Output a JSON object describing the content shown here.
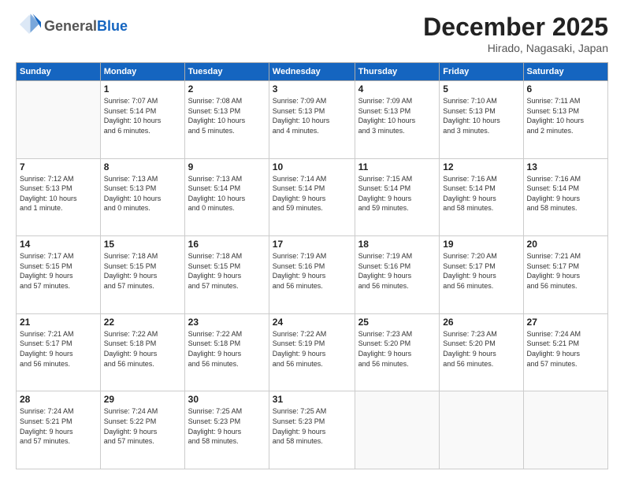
{
  "logo": {
    "general": "General",
    "blue": "Blue"
  },
  "header": {
    "month": "December 2025",
    "location": "Hirado, Nagasaki, Japan"
  },
  "days_of_week": [
    "Sunday",
    "Monday",
    "Tuesday",
    "Wednesday",
    "Thursday",
    "Friday",
    "Saturday"
  ],
  "weeks": [
    [
      {
        "day": "",
        "info": ""
      },
      {
        "day": "1",
        "info": "Sunrise: 7:07 AM\nSunset: 5:14 PM\nDaylight: 10 hours\nand 6 minutes."
      },
      {
        "day": "2",
        "info": "Sunrise: 7:08 AM\nSunset: 5:13 PM\nDaylight: 10 hours\nand 5 minutes."
      },
      {
        "day": "3",
        "info": "Sunrise: 7:09 AM\nSunset: 5:13 PM\nDaylight: 10 hours\nand 4 minutes."
      },
      {
        "day": "4",
        "info": "Sunrise: 7:09 AM\nSunset: 5:13 PM\nDaylight: 10 hours\nand 3 minutes."
      },
      {
        "day": "5",
        "info": "Sunrise: 7:10 AM\nSunset: 5:13 PM\nDaylight: 10 hours\nand 3 minutes."
      },
      {
        "day": "6",
        "info": "Sunrise: 7:11 AM\nSunset: 5:13 PM\nDaylight: 10 hours\nand 2 minutes."
      }
    ],
    [
      {
        "day": "7",
        "info": "Sunrise: 7:12 AM\nSunset: 5:13 PM\nDaylight: 10 hours\nand 1 minute."
      },
      {
        "day": "8",
        "info": "Sunrise: 7:13 AM\nSunset: 5:13 PM\nDaylight: 10 hours\nand 0 minutes."
      },
      {
        "day": "9",
        "info": "Sunrise: 7:13 AM\nSunset: 5:14 PM\nDaylight: 10 hours\nand 0 minutes."
      },
      {
        "day": "10",
        "info": "Sunrise: 7:14 AM\nSunset: 5:14 PM\nDaylight: 9 hours\nand 59 minutes."
      },
      {
        "day": "11",
        "info": "Sunrise: 7:15 AM\nSunset: 5:14 PM\nDaylight: 9 hours\nand 59 minutes."
      },
      {
        "day": "12",
        "info": "Sunrise: 7:16 AM\nSunset: 5:14 PM\nDaylight: 9 hours\nand 58 minutes."
      },
      {
        "day": "13",
        "info": "Sunrise: 7:16 AM\nSunset: 5:14 PM\nDaylight: 9 hours\nand 58 minutes."
      }
    ],
    [
      {
        "day": "14",
        "info": "Sunrise: 7:17 AM\nSunset: 5:15 PM\nDaylight: 9 hours\nand 57 minutes."
      },
      {
        "day": "15",
        "info": "Sunrise: 7:18 AM\nSunset: 5:15 PM\nDaylight: 9 hours\nand 57 minutes."
      },
      {
        "day": "16",
        "info": "Sunrise: 7:18 AM\nSunset: 5:15 PM\nDaylight: 9 hours\nand 57 minutes."
      },
      {
        "day": "17",
        "info": "Sunrise: 7:19 AM\nSunset: 5:16 PM\nDaylight: 9 hours\nand 56 minutes."
      },
      {
        "day": "18",
        "info": "Sunrise: 7:19 AM\nSunset: 5:16 PM\nDaylight: 9 hours\nand 56 minutes."
      },
      {
        "day": "19",
        "info": "Sunrise: 7:20 AM\nSunset: 5:17 PM\nDaylight: 9 hours\nand 56 minutes."
      },
      {
        "day": "20",
        "info": "Sunrise: 7:21 AM\nSunset: 5:17 PM\nDaylight: 9 hours\nand 56 minutes."
      }
    ],
    [
      {
        "day": "21",
        "info": "Sunrise: 7:21 AM\nSunset: 5:17 PM\nDaylight: 9 hours\nand 56 minutes."
      },
      {
        "day": "22",
        "info": "Sunrise: 7:22 AM\nSunset: 5:18 PM\nDaylight: 9 hours\nand 56 minutes."
      },
      {
        "day": "23",
        "info": "Sunrise: 7:22 AM\nSunset: 5:18 PM\nDaylight: 9 hours\nand 56 minutes."
      },
      {
        "day": "24",
        "info": "Sunrise: 7:22 AM\nSunset: 5:19 PM\nDaylight: 9 hours\nand 56 minutes."
      },
      {
        "day": "25",
        "info": "Sunrise: 7:23 AM\nSunset: 5:20 PM\nDaylight: 9 hours\nand 56 minutes."
      },
      {
        "day": "26",
        "info": "Sunrise: 7:23 AM\nSunset: 5:20 PM\nDaylight: 9 hours\nand 56 minutes."
      },
      {
        "day": "27",
        "info": "Sunrise: 7:24 AM\nSunset: 5:21 PM\nDaylight: 9 hours\nand 57 minutes."
      }
    ],
    [
      {
        "day": "28",
        "info": "Sunrise: 7:24 AM\nSunset: 5:21 PM\nDaylight: 9 hours\nand 57 minutes."
      },
      {
        "day": "29",
        "info": "Sunrise: 7:24 AM\nSunset: 5:22 PM\nDaylight: 9 hours\nand 57 minutes."
      },
      {
        "day": "30",
        "info": "Sunrise: 7:25 AM\nSunset: 5:23 PM\nDaylight: 9 hours\nand 58 minutes."
      },
      {
        "day": "31",
        "info": "Sunrise: 7:25 AM\nSunset: 5:23 PM\nDaylight: 9 hours\nand 58 minutes."
      },
      {
        "day": "",
        "info": ""
      },
      {
        "day": "",
        "info": ""
      },
      {
        "day": "",
        "info": ""
      }
    ]
  ]
}
